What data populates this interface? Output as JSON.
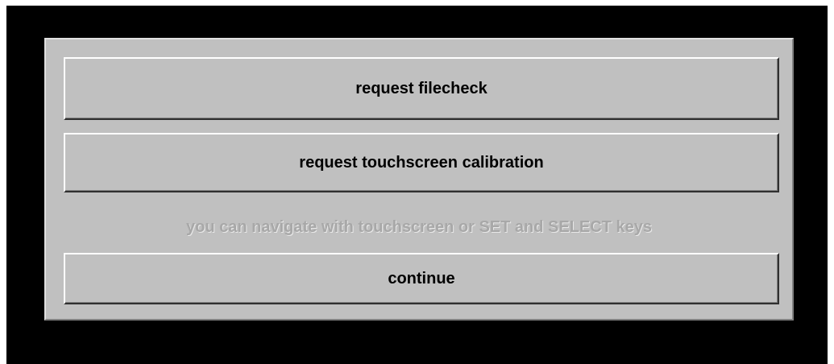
{
  "dialog": {
    "buttons": {
      "filecheck": "request filecheck",
      "calibration": "request touchscreen calibration",
      "continue": "continue"
    },
    "hint": "you can navigate with touchscreen or SET and SELECT keys"
  },
  "colors": {
    "background": "#000000",
    "panel": "#c0c0c0",
    "button_text": "#000000",
    "hint_text": "#a8a8a8"
  }
}
